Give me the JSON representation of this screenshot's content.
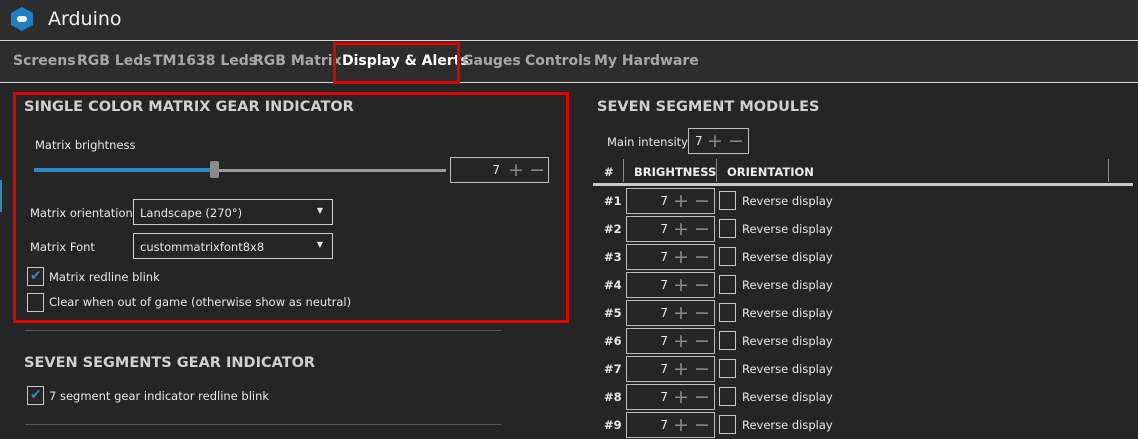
{
  "app": {
    "title": "Arduino",
    "logo_icon": "gamepad-icon"
  },
  "tabs": [
    {
      "label": "Screens"
    },
    {
      "label": "RGB Leds"
    },
    {
      "label": "TM1638 Leds"
    },
    {
      "label": "RGB Matrix"
    },
    {
      "label": "Display & Alerts",
      "active": true
    },
    {
      "label": "Gauges"
    },
    {
      "label": "Controls"
    },
    {
      "label": "My Hardware"
    }
  ],
  "matrix": {
    "title": "SINGLE COLOR MATRIX GEAR INDICATOR",
    "brightness_label": "Matrix brightness",
    "brightness_value": "7",
    "brightness_max": 15,
    "orientation_label": "Matrix orientation",
    "orientation_value": "Landscape (270°)",
    "font_label": "Matrix Font",
    "font_value": "custommatrixfont8x8",
    "redline_label": "Matrix redline blink",
    "redline_checked": true,
    "clear_label": "Clear when out of game (otherwise show as neutral)",
    "clear_checked": false
  },
  "seven_gear": {
    "title": "SEVEN SEGMENTS GEAR INDICATOR",
    "redline_label": "7 segment gear indicator redline blink",
    "redline_checked": true
  },
  "modules": {
    "title": "SEVEN SEGMENT MODULES",
    "main_intensity_label": "Main intensity",
    "main_intensity_value": "7",
    "columns": [
      "#",
      "BRIGHTNESS",
      "ORIENTATION"
    ],
    "rows": [
      {
        "id": "#1",
        "brightness": "7",
        "orientation": "Reverse display"
      },
      {
        "id": "#2",
        "brightness": "7",
        "orientation": "Reverse display"
      },
      {
        "id": "#3",
        "brightness": "7",
        "orientation": "Reverse display"
      },
      {
        "id": "#4",
        "brightness": "7",
        "orientation": "Reverse display"
      },
      {
        "id": "#5",
        "brightness": "7",
        "orientation": "Reverse display"
      },
      {
        "id": "#6",
        "brightness": "7",
        "orientation": "Reverse display"
      },
      {
        "id": "#7",
        "brightness": "7",
        "orientation": "Reverse display"
      },
      {
        "id": "#8",
        "brightness": "7",
        "orientation": "Reverse display"
      },
      {
        "id": "#9",
        "brightness": "7",
        "orientation": "Reverse display"
      }
    ]
  },
  "symbols": {
    "plus": "+",
    "minus": "−",
    "caret": "▼"
  }
}
